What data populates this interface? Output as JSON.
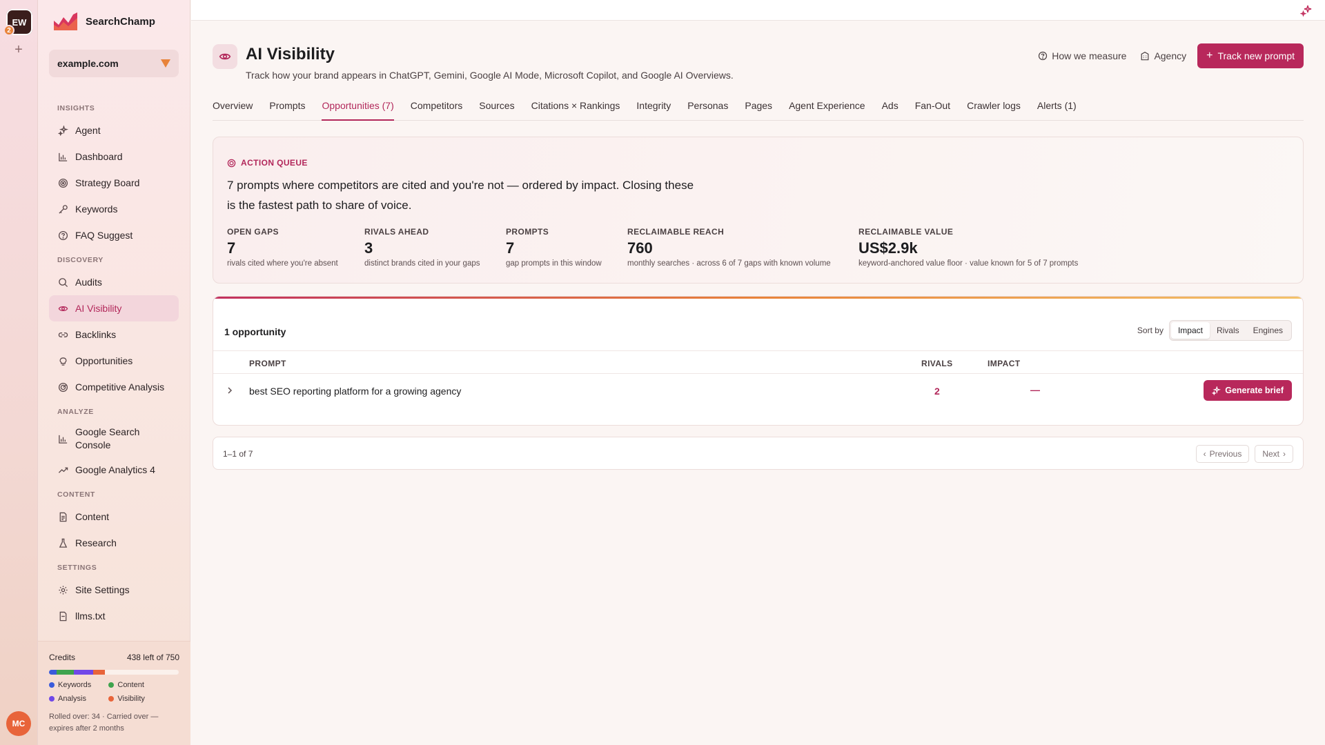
{
  "workspace": {
    "initials": "EW",
    "badge": "2",
    "add": "+"
  },
  "user": {
    "initials": "MC"
  },
  "brand": {
    "name": "SearchChamp"
  },
  "site": {
    "selected": "example.com"
  },
  "nav": {
    "insights_label": "INSIGHTS",
    "insights": [
      {
        "label": "Agent",
        "icon": "sparkle-icon"
      },
      {
        "label": "Dashboard",
        "icon": "bar-chart-icon"
      },
      {
        "label": "Strategy Board",
        "icon": "target-icon"
      },
      {
        "label": "Keywords",
        "icon": "key-icon"
      },
      {
        "label": "FAQ Suggest",
        "icon": "help-circle-icon"
      }
    ],
    "discovery_label": "DISCOVERY",
    "discovery": [
      {
        "label": "Audits",
        "icon": "search-icon"
      },
      {
        "label": "AI Visibility",
        "icon": "eye-icon"
      },
      {
        "label": "Backlinks",
        "icon": "link-icon"
      },
      {
        "label": "Opportunities",
        "icon": "lightbulb-icon"
      },
      {
        "label": "Competitive Analysis",
        "icon": "radar-icon"
      }
    ],
    "analyze_label": "ANALYZE",
    "analyze": [
      {
        "label": "Google Search Console",
        "icon": "bar-chart-icon"
      },
      {
        "label": "Google Analytics 4",
        "icon": "trend-up-icon"
      }
    ],
    "content_label": "CONTENT",
    "content": [
      {
        "label": "Content",
        "icon": "document-icon"
      },
      {
        "label": "Research",
        "icon": "flask-icon"
      }
    ],
    "settings_label": "SETTINGS",
    "settings": [
      {
        "label": "Site Settings",
        "icon": "gear-icon"
      },
      {
        "label": "llms.txt",
        "icon": "file-icon"
      }
    ]
  },
  "credits": {
    "label": "Credits",
    "remaining": "438 left of 750",
    "used_fractions": {
      "keywords": 0.06,
      "content": 0.13,
      "analysis": 0.15,
      "visibility": 0.09
    },
    "colors": {
      "keywords": "#3b5bdb",
      "content": "#3fa34d",
      "analysis": "#7048e8",
      "visibility": "#e8643a"
    },
    "legend": {
      "keywords": "Keywords",
      "content": "Content",
      "analysis": "Analysis",
      "visibility": "Visibility"
    },
    "note": "Rolled over: 34 · Carried over — expires after 2 months"
  },
  "header": {
    "title": "AI Visibility",
    "subtitle": "Track how your brand appears in ChatGPT, Gemini, Google AI Mode, Microsoft Copilot, and Google AI Overviews.",
    "how_we_measure": "How we measure",
    "agency": "Agency",
    "track_button": "Track new prompt"
  },
  "tabs": [
    "Overview",
    "Prompts",
    "Opportunities (7)",
    "Competitors",
    "Sources",
    "Citations × Rankings",
    "Integrity",
    "Personas",
    "Pages",
    "Agent Experience",
    "Ads",
    "Fan-Out",
    "Crawler logs",
    "Alerts (1)"
  ],
  "active_tab": "Opportunities (7)",
  "queue": {
    "label": "ACTION QUEUE",
    "text": "7 prompts where competitors are cited and you're not — ordered by impact. Closing these is the fastest path to share of voice.",
    "stats": [
      {
        "key": "OPEN GAPS",
        "value": "7",
        "desc": "rivals cited where you're absent"
      },
      {
        "key": "RIVALS AHEAD",
        "value": "3",
        "desc": "distinct brands cited in your gaps"
      },
      {
        "key": "PROMPTS",
        "value": "7",
        "desc": "gap prompts in this window"
      },
      {
        "key": "RECLAIMABLE REACH",
        "value": "760",
        "desc": "monthly searches · across 6 of 7 gaps with known volume"
      },
      {
        "key": "RECLAIMABLE VALUE",
        "value": "US$2.9k",
        "desc": "keyword-anchored value floor · value known for 5 of 7 prompts"
      }
    ]
  },
  "opportunities": {
    "count_label": "1 opportunity",
    "sort_label": "Sort by",
    "sort_options": [
      "Impact",
      "Rivals",
      "Engines"
    ],
    "sort_active": "Impact",
    "columns": {
      "prompt": "PROMPT",
      "rivals": "RIVALS",
      "impact": "IMPACT"
    },
    "rows": [
      {
        "prompt": "best SEO reporting platform for a growing agency",
        "rivals": "2",
        "impact": "—",
        "action": "Generate brief"
      }
    ]
  },
  "pager": {
    "info": "1–1 of 7",
    "previous": "Previous",
    "next": "Next"
  }
}
